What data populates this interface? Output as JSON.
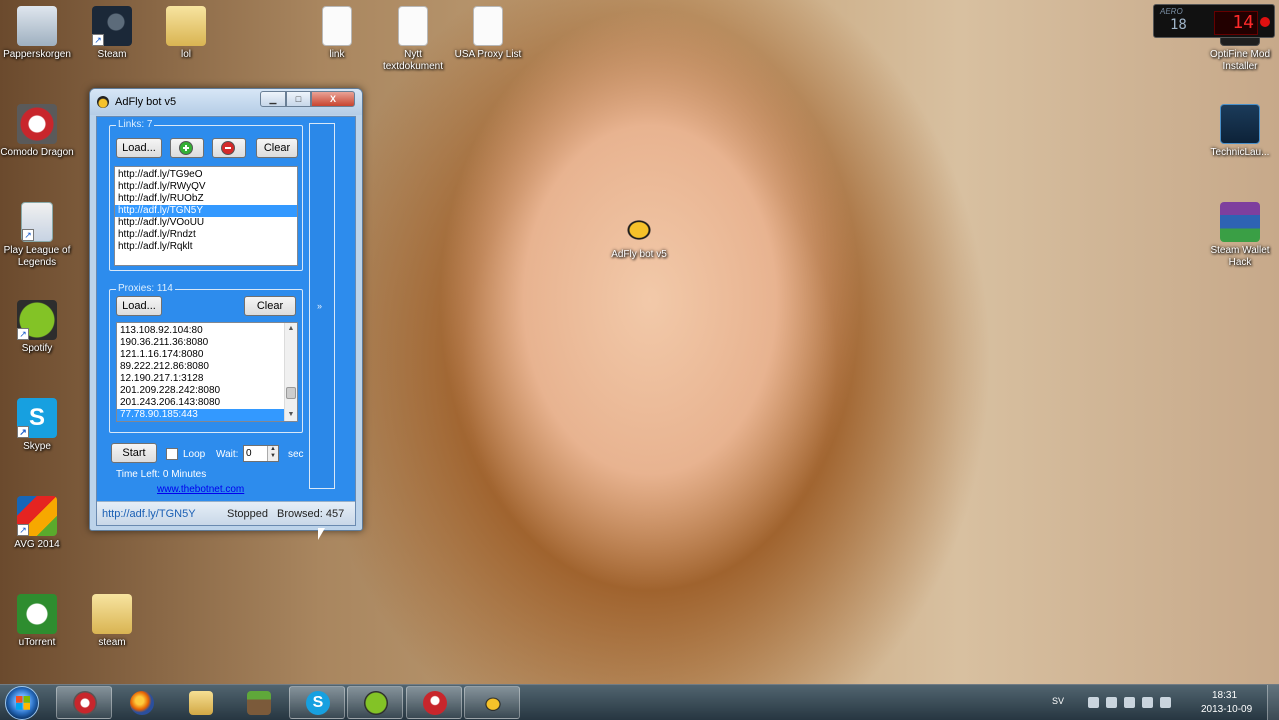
{
  "desktop": {
    "icons": [
      {
        "label": "Papperskorgen",
        "icon": "recycle-bin-icon"
      },
      {
        "label": "Steam",
        "icon": "steam-icon"
      },
      {
        "label": "lol",
        "icon": "folder-icon"
      },
      {
        "label": "link",
        "icon": "document-icon"
      },
      {
        "label": "Nytt textdokument",
        "icon": "document-icon"
      },
      {
        "label": "USA Proxy List",
        "icon": "document-icon"
      },
      {
        "label": "Comodo Dragon",
        "icon": "comodo-dragon-icon"
      },
      {
        "label": "Play League of Legends",
        "icon": "league-of-legends-icon"
      },
      {
        "label": "Spotify",
        "icon": "spotify-icon"
      },
      {
        "label": "Skype",
        "icon": "skype-icon"
      },
      {
        "label": "AVG 2014",
        "icon": "avg-icon"
      },
      {
        "label": "uTorrent",
        "icon": "utorrent-icon"
      },
      {
        "label": "steam",
        "icon": "folder-icon"
      },
      {
        "label": "OptiFine Mod Installer",
        "icon": "optifine-icon"
      },
      {
        "label": "TechnicLau...",
        "icon": "technic-launcher-icon"
      },
      {
        "label": "Steam Wallet Hack",
        "icon": "winrar-icon"
      },
      {
        "label": "AdFly bot v5",
        "icon": "bee-icon"
      }
    ]
  },
  "overlay": {
    "fraps_label": "AERO",
    "fps_small": "18",
    "fps_big": "14"
  },
  "window": {
    "title": "AdFly bot v5",
    "minimize": "▁",
    "maximize": "□",
    "close": "X",
    "links": {
      "group_title": "Links: 7",
      "load_button": "Load...",
      "clear_button": "Clear",
      "items": [
        "http://adf.ly/TG9eO",
        "http://adf.ly/RWyQV",
        "http://adf.ly/RUObZ",
        "http://adf.ly/TGN5Y",
        "http://adf.ly/VOoUU",
        "http://adf.ly/Rndzt",
        "http://adf.ly/Rqklt"
      ],
      "selected_index": 3
    },
    "proxies": {
      "group_title": "Proxies: 114",
      "load_button": "Load...",
      "clear_button": "Clear",
      "items": [
        "113.108.92.104:80",
        "190.36.211.36:8080",
        "121.1.16.174:8080",
        "89.222.212.86:8080",
        "12.190.217.1:3128",
        "201.209.228.242:8080",
        "201.243.206.143:8080",
        "77.78.90.185:443"
      ],
      "selected_index": 7
    },
    "controls": {
      "start_button": "Start",
      "loop_label": "Loop",
      "loop_checked": false,
      "wait_label": "Wait:",
      "wait_value": "0",
      "sec_label": "sec",
      "time_left": "Time Left: 0 Minutes",
      "link": "www.thebotnet.com"
    },
    "side_arrow": "»",
    "status": {
      "current_url": "http://adf.ly/TGN5Y",
      "state": "Stopped",
      "browsed": "Browsed: 457"
    }
  },
  "taskbar": {
    "items": [
      {
        "name": "comodo-dragon",
        "active": true
      },
      {
        "name": "firefox",
        "active": false
      },
      {
        "name": "explorer",
        "active": false
      },
      {
        "name": "minecraft",
        "active": false
      },
      {
        "name": "skype",
        "active": true
      },
      {
        "name": "spotify",
        "active": true
      },
      {
        "name": "comodo-dragon-2",
        "active": true
      },
      {
        "name": "adfly-bot",
        "active": true
      }
    ],
    "tray": {
      "language": "SV",
      "time": "18:31",
      "date": "2013-10-09"
    }
  }
}
